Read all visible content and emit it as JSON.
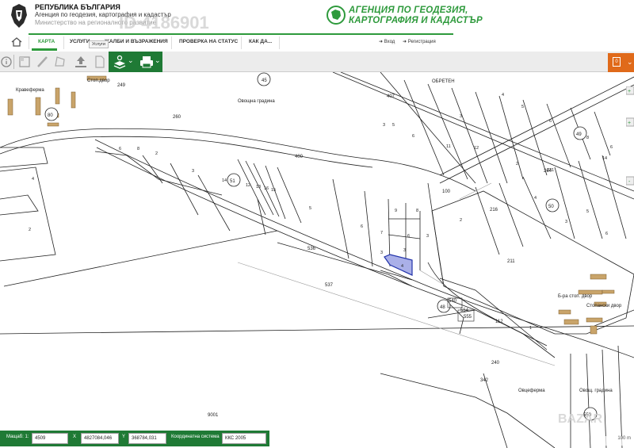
{
  "header": {
    "gov_title": "РЕПУБЛИКА БЪЛГАРИЯ",
    "gov_subtitle_1": "Агенция по геодезия, картография и кадастър",
    "gov_subtitle_2": "Министерство на регионалното развитие",
    "agency_line1": "АГЕНЦИЯ ПО ГЕОДЕЗИЯ,",
    "agency_line2": "КАРТОГРАФИЯ И КАДАСТЪР",
    "watermark": "ID 4186901"
  },
  "nav": {
    "tabs": [
      "КАРТА",
      "УСЛУГИ",
      "ЖАЛБИ И ВЪЗРАЖЕНИЯ",
      "ПРОВЕРКА НА СТАТУС",
      "КАК ДА..."
    ],
    "tooltip": "Услуги",
    "login": "Вход",
    "register": "Регистрация"
  },
  "toolbar": {
    "icons": [
      "info-icon",
      "measure-area-icon",
      "ruler-icon",
      "polygon-icon",
      "upload-icon",
      "document-icon",
      "layers-toggle-icon",
      "print-icon"
    ],
    "layers_label": "0"
  },
  "map": {
    "labels": [
      "ОБРЕТЕН",
      "Овощна градина",
      "Б-ра стоп. двор",
      "Стопански двор",
      "Овощна градина",
      "Овощ. градина",
      "Стоп.двор",
      "Кравеферма",
      "Овцеферма",
      "249",
      "260",
      "400",
      "536",
      "537",
      "100",
      "216",
      "211",
      "240",
      "342",
      "9001",
      "555",
      "554",
      "540",
      "112",
      "264",
      "407"
    ],
    "quarter_numbers": [
      "45",
      "49",
      "50",
      "51",
      "80",
      "48",
      "550"
    ],
    "corner_watermark": "BAZAR"
  },
  "statusbar": {
    "scale_label": "Мащаб: 1:",
    "scale_value": "4509",
    "x_label": "X",
    "x_value": "4827084,046",
    "y_label": "Y",
    "y_value": "368784,031",
    "crs_label": "Координатна система",
    "crs_value": "ККС 2005"
  },
  "scale_bar": "100 m",
  "colors": {
    "brand_green": "#2e9a3c",
    "toolbar_green": "#1f7a35",
    "layers_orange": "#e06a1a",
    "selected_parcel": "#aab0e8",
    "building": "#c9a46a"
  }
}
